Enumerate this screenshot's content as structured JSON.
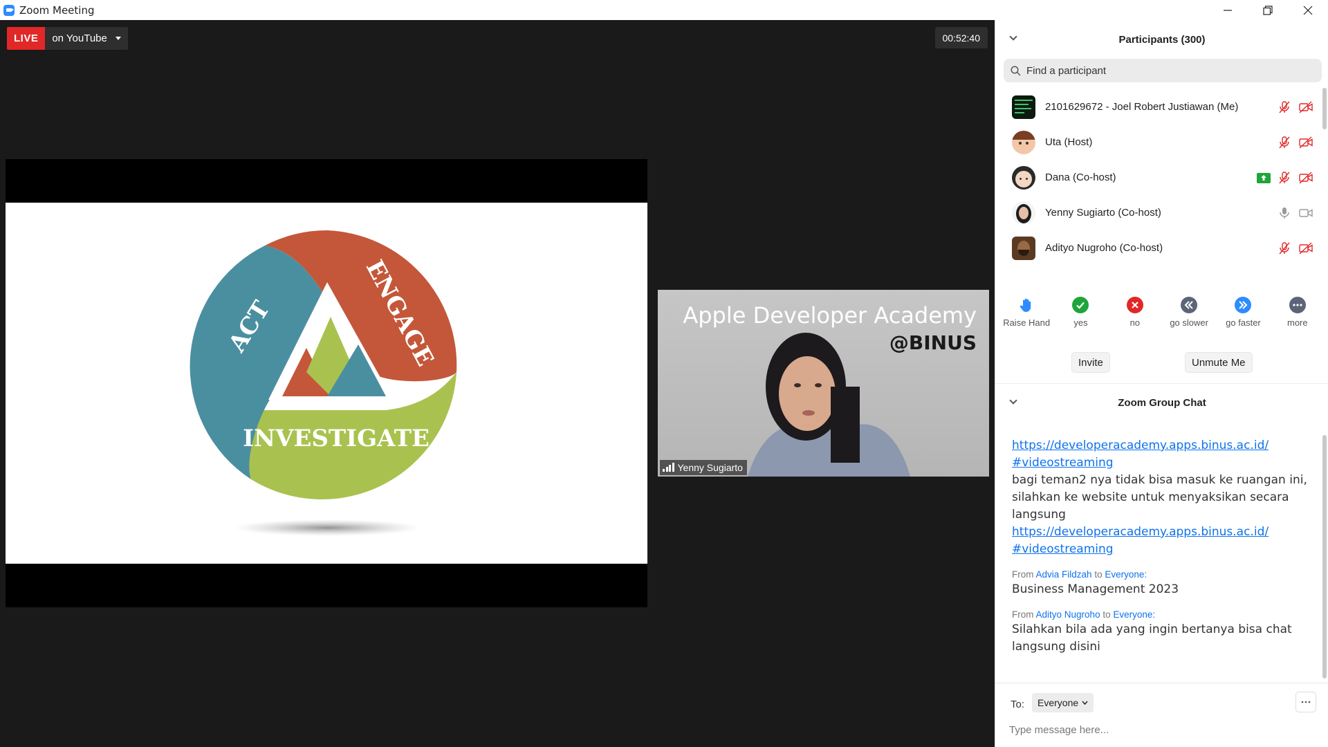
{
  "window": {
    "title": "Zoom Meeting"
  },
  "stream": {
    "live_label": "LIVE",
    "platform": "on YouTube"
  },
  "timer": "00:52:40",
  "slide": {
    "words": [
      "ACT",
      "ENGAGE",
      "INVESTIGATE"
    ],
    "colors": {
      "act": "#4a8fa0",
      "engage": "#c4573a",
      "investigate": "#a9c24f"
    }
  },
  "speaker": {
    "brand_line1": "Apple Developer Academy",
    "brand_line2": "@BINUS",
    "name": "Yenny Sugiarto"
  },
  "participants": {
    "title": "Participants (300)",
    "search_placeholder": "Find a participant",
    "list": [
      {
        "name": "2101629672 - Joel Robert Justiawan (Me)",
        "mic": "muted",
        "video": "off",
        "sharing": false
      },
      {
        "name": "Uta (Host)",
        "mic": "muted",
        "video": "off",
        "sharing": false
      },
      {
        "name": "Dana (Co-host)",
        "mic": "muted",
        "video": "off",
        "sharing": true
      },
      {
        "name": "Yenny Sugiarto (Co-host)",
        "mic": "on",
        "video": "on",
        "sharing": false
      },
      {
        "name": "Adityo Nugroho (Co-host)",
        "mic": "muted",
        "video": "off",
        "sharing": false
      }
    ]
  },
  "reactions": [
    {
      "label": "Raise Hand",
      "icon": "raise-hand-icon",
      "color": "#2d8cff"
    },
    {
      "label": "yes",
      "icon": "check-icon",
      "color": "#1fa539"
    },
    {
      "label": "no",
      "icon": "x-icon",
      "color": "#e02828"
    },
    {
      "label": "go slower",
      "icon": "rewind-icon",
      "color": "#5c6478"
    },
    {
      "label": "go faster",
      "icon": "fast-forward-icon",
      "color": "#2d8cff"
    },
    {
      "label": "more",
      "icon": "more-icon",
      "color": "#5c6478"
    }
  ],
  "buttons": {
    "invite": "Invite",
    "unmute": "Unmute Me"
  },
  "chat": {
    "title": "Zoom Group Chat",
    "messages": [
      {
        "link1": "https://developeracademy.apps.binus.ac.id/",
        "link2": "#videostreaming"
      },
      {
        "text": "bagi teman2 nya tidak bisa masuk ke ruangan ini, silahkan ke website untuk menyaksikan secara langsung",
        "link1": "https://developeracademy.apps.binus.ac.id/",
        "link2": "#videostreaming"
      },
      {
        "from_prefix": "From",
        "sender": "Advia Fildzah",
        "to_word": "to",
        "recipient": "Everyone:",
        "text": "Business Management 2023"
      },
      {
        "from_prefix": "From",
        "sender": "Adityo Nugroho",
        "to_word": "to",
        "recipient": "Everyone:",
        "text": "Silahkan bila ada yang ingin bertanya bisa chat langsung disini"
      }
    ],
    "to_label": "To:",
    "to_value": "Everyone",
    "input_placeholder": "Type message here..."
  }
}
